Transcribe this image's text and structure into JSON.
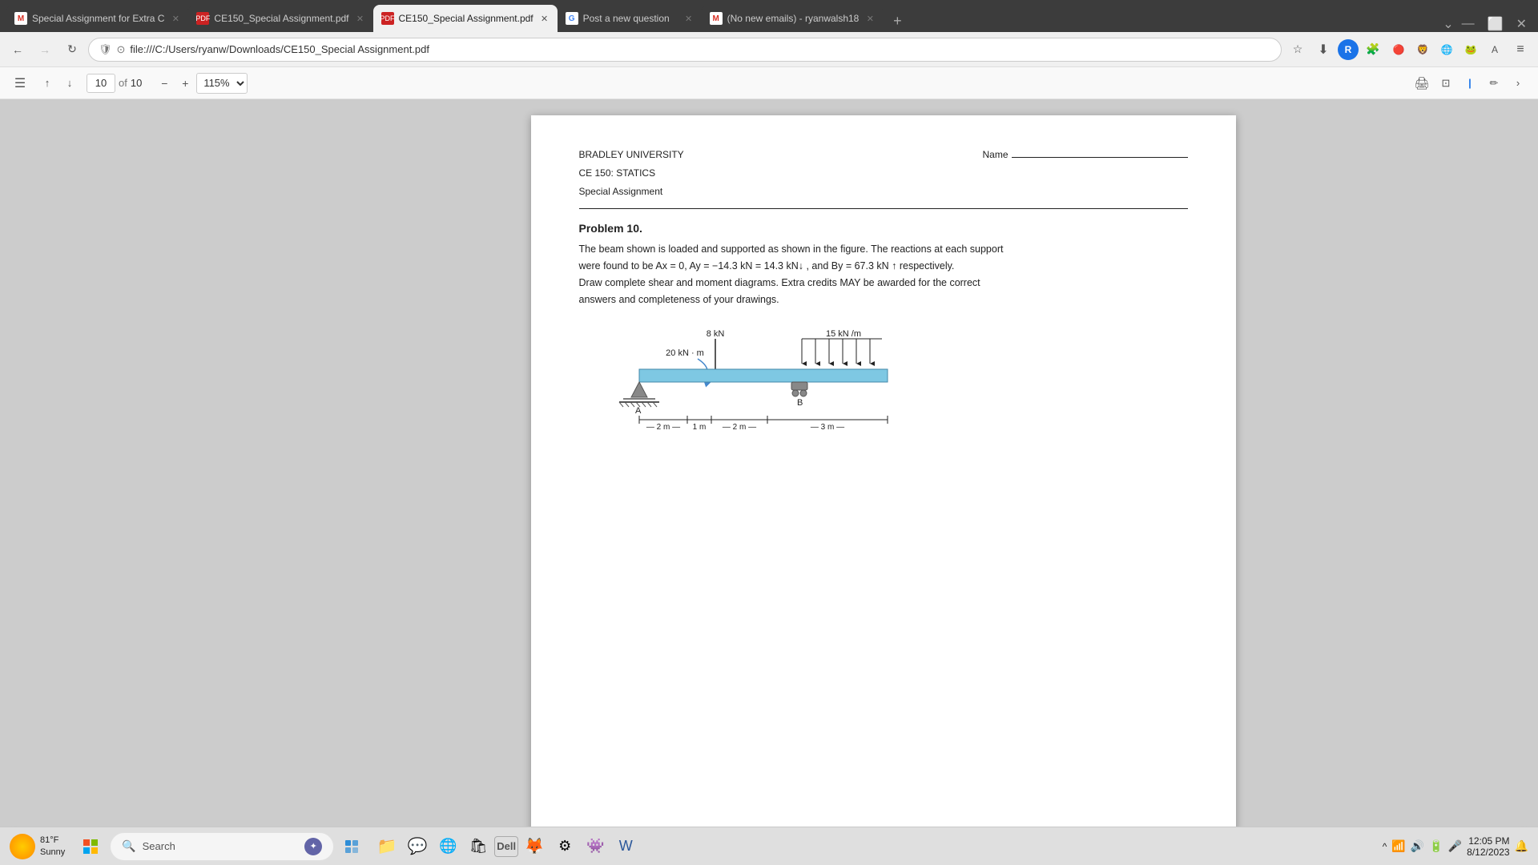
{
  "browser": {
    "tabs": [
      {
        "id": "tab1",
        "title": "Special Assignment for Extra C",
        "favicon": "M",
        "favicon_color": "#d93025",
        "active": false,
        "closeable": true
      },
      {
        "id": "tab2",
        "title": "CE150_Special Assignment.pdf",
        "favicon": "📄",
        "active": false,
        "closeable": true
      },
      {
        "id": "tab3",
        "title": "CE150_Special Assignment.pdf",
        "favicon": "📄",
        "active": true,
        "closeable": true
      },
      {
        "id": "tab4",
        "title": "Post a new question",
        "favicon": "G",
        "favicon_color": "#4285f4",
        "active": false,
        "closeable": true
      },
      {
        "id": "tab5",
        "title": "(No new emails) - ryanwalsh18",
        "favicon": "M",
        "favicon_color": "#d93025",
        "active": false,
        "closeable": true
      }
    ],
    "url": "file:///C:/Users/ryanw/Downloads/CE150_Special Assignment.pdf",
    "back_disabled": false,
    "forward_disabled": true
  },
  "pdf": {
    "current_page": "10",
    "total_pages": "10",
    "zoom": "115%",
    "content": {
      "university": "BRADLEY UNIVERSITY",
      "course": "CE 150: STATICS",
      "assignment": "Special Assignment",
      "name_label": "Name",
      "problem_number": "Problem 10.",
      "problem_text_1": "The beam shown is loaded and supported as shown in the figure.  The reactions at each support",
      "problem_text_2": "were found to be Ax = 0, Ay = −14.3 kN = 14.3 kN↓ , and By = 67.3 kN ↑ respectively.",
      "problem_text_3": "Draw complete shear and moment diagrams.  Extra credits MAY be awarded for the correct",
      "problem_text_4": "answers and completeness of your drawings."
    }
  },
  "taskbar": {
    "weather_temp": "81°F",
    "weather_condition": "Sunny",
    "search_placeholder": "Search",
    "time": "12:05 PM",
    "date": "8/12/2023"
  },
  "icons": {
    "back": "←",
    "forward": "→",
    "refresh": "↻",
    "shield": "🛡",
    "star": "☆",
    "download": "↓",
    "extensions": "🧩",
    "menu": "≡",
    "close": "✕",
    "new_tab": "+",
    "sidebar": "⊟",
    "up": "↑",
    "down": "↓",
    "minus": "−",
    "plus": "+",
    "print": "🖨",
    "fit": "⊡",
    "cursor": "|",
    "pen": "✏",
    "more": "››"
  }
}
